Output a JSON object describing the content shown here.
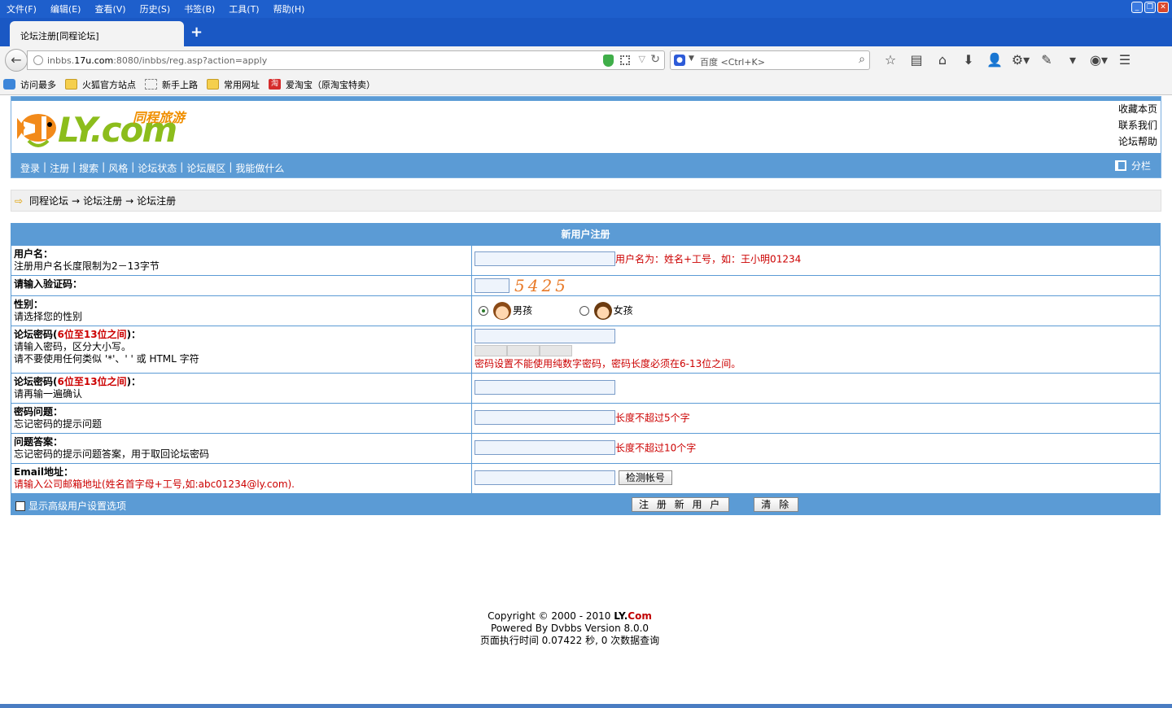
{
  "browser": {
    "menu": [
      "文件(F)",
      "编辑(E)",
      "查看(V)",
      "历史(S)",
      "书签(B)",
      "工具(T)",
      "帮助(H)"
    ],
    "tab_title": "论坛注册[同程论坛]",
    "new_tab_symbol": "+",
    "url_prefix": "inbbs.",
    "url_domain": "17u.com",
    "url_rest": ":8080/inbbs/reg.asp?action=apply",
    "search_placeholder": "百度 <Ctrl+K>",
    "bookmarks": [
      {
        "label": "访问最多",
        "icon": "search-bookmark-icon"
      },
      {
        "label": "火狐官方站点",
        "icon": "folder-icon"
      },
      {
        "label": "新手上路",
        "icon": "page-icon"
      },
      {
        "label": "常用网址",
        "icon": "folder-icon"
      },
      {
        "label": "爱淘宝（原淘宝特卖）",
        "icon": "taobao-icon"
      }
    ],
    "taobao_glyph": "淘"
  },
  "site": {
    "logo_text": "LY.com",
    "logo_cn": "同程旅游",
    "top_links": [
      "收藏本页",
      "联系我们",
      "论坛帮助"
    ],
    "nav_links": [
      "登录",
      "注册",
      "搜索",
      "风格",
      "论坛状态",
      "论坛展区",
      "我能做什么"
    ],
    "nav_separator": "|",
    "columns_label": "分栏"
  },
  "breadcrumb": {
    "items": [
      "同程论坛",
      "论坛注册",
      "论坛注册"
    ],
    "separator": "→"
  },
  "form": {
    "title": "新用户注册",
    "username_label": "用户名：",
    "username_desc": "注册用户名长度限制为2－13字节",
    "username_hint": "用户名为：姓名+工号，如：王小明01234",
    "captcha_label": "请输入验证码：",
    "captcha_text": "5425",
    "gender_label": "性别：",
    "gender_desc": "请选择您的性别",
    "gender_male": "男孩",
    "gender_female": "女孩",
    "password_label_a": "论坛密码(",
    "password_label_red": "6位至13位之间",
    "password_label_b": ")：",
    "password_desc1": "请输入密码，区分大小写。",
    "password_desc2": "请不要使用任何类似 '*'、' ' 或 HTML 字符",
    "password_hint": "密码设置不能使用纯数字密码，密码长度必须在6-13位之间。",
    "confirm_desc": "请再输一遍确认",
    "question_label": "密码问题：",
    "question_desc": "忘记密码的提示问题",
    "question_hint": "长度不超过5个字",
    "answer_label": "问题答案：",
    "answer_desc": "忘记密码的提示问题答案，用于取回论坛密码",
    "answer_hint": "长度不超过10个字",
    "email_label": "Email地址：",
    "email_desc": "请输入公司邮箱地址(姓名首字母+工号,如:abc01234@ly.com).",
    "check_button": "检测帐号",
    "advanced_label": "显示高级用户设置选项",
    "submit_button": "注 册 新 用 户",
    "clear_button": "清 除"
  },
  "footer": {
    "copyright_prefix": "Copyright © 2000 - 2010 ",
    "brand_a": "LY.",
    "brand_b": "Com",
    "powered": "Powered By Dvbbs Version 8.0.0",
    "exec_time": "页面执行时间 0.07422 秒, 0 次数据查询"
  },
  "colors": {
    "accent": "#5b9bd5",
    "hint_red": "#cc0000",
    "logo_green": "#8cbd1c",
    "logo_orange": "#f08f00"
  }
}
